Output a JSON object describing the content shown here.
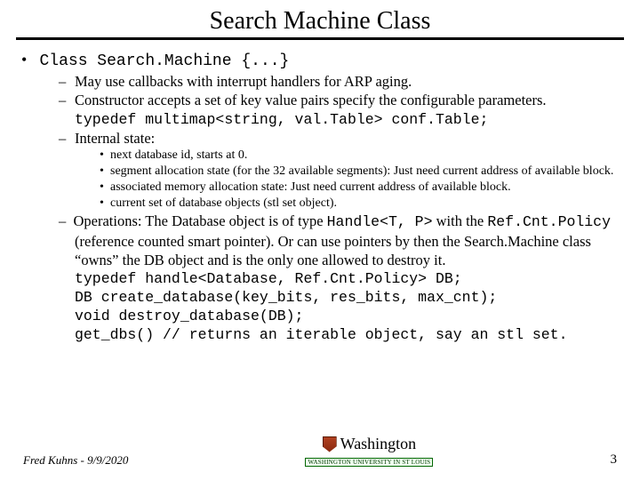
{
  "title": "Search Machine Class",
  "lvl1": {
    "bullet": "•",
    "text": "Class Search.Machine {...}"
  },
  "sub": {
    "a": "May use callbacks with interrupt handlers for ARP aging.",
    "b": "Constructor accepts a set of key value pairs specify the configurable parameters.",
    "typedef": "typedef multimap<string, val.Table> conf.Table;",
    "c": "Internal state:"
  },
  "state": {
    "s1": "next database id, starts at 0.",
    "s2": "segment allocation state (for the 32 available segments):   Just need current address of available block.",
    "s3": "associated memory allocation state: Just need current address of available block.",
    "s4": "current set of database objects (stl set object)."
  },
  "ops": {
    "lead_dash": "–",
    "line1a": "Operations: The Database object is of type ",
    "handle": "Handle<T, P>",
    "line1b": " with the ",
    "refcnt": "Ref.Cnt.Policy",
    "line2": "(reference counted smart pointer). Or can use pointers by then the Search.Machine class “owns” the DB object and is the only one allowed to destroy it.",
    "c1": "typedef handle<Database, Ref.Cnt.Policy> DB;",
    "c2": "DB create_database(key_bits, res_bits, max_cnt);",
    "c3": "void destroy_database(DB);",
    "c4": "get_dbs() // returns an iterable object, say an stl set."
  },
  "footer": {
    "left": "Fred Kuhns - 9/9/2020",
    "uni": "Washington",
    "sub": "WASHINGTON UNIVERSITY IN ST LOUIS",
    "page": "3"
  },
  "glyph": {
    "dash": "–",
    "dot": "•"
  }
}
